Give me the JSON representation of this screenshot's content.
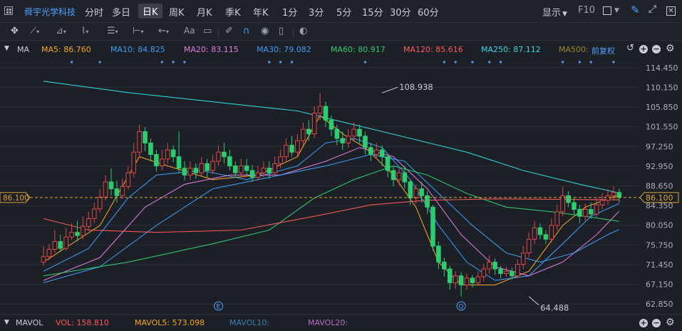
{
  "header": {
    "stock_name": "舜宇光学科技",
    "tabs": [
      "分时",
      "多日",
      "日K",
      "周K",
      "月K",
      "季K",
      "年K",
      "1分",
      "3分",
      "5分",
      "15分",
      "30分",
      "60分"
    ],
    "active_tab": "日K",
    "display_label": "显示",
    "f10_label": "F10"
  },
  "toolbar": {
    "text_tool_label": "Aa"
  },
  "ma_bar": {
    "label": "MA",
    "items": [
      {
        "text": "MA5: 86.760",
        "color": "#f5a623"
      },
      {
        "text": "MA10: 84.825",
        "color": "#3d9df5"
      },
      {
        "text": "MA20: 83.115",
        "color": "#e07ee0"
      },
      {
        "text": "MA30: 79.082",
        "color": "#3d9df5"
      },
      {
        "text": "MA60: 80.917",
        "color": "#2ecc71"
      },
      {
        "text": "MA120: 85.616",
        "color": "#ff5a5a"
      },
      {
        "text": "MA250: 87.112",
        "color": "#33d9e0"
      },
      {
        "text": "MA500:",
        "color": "#a0862e"
      }
    ],
    "adjust_label": "前复权"
  },
  "price_axis": [
    "114.450",
    "110.150",
    "105.850",
    "101.550",
    "97.250",
    "92.950",
    "88.650",
    "84.350",
    "80.050",
    "75.750",
    "71.450",
    "67.150",
    "62.850"
  ],
  "current_price": "86.100",
  "annotations": {
    "high": "108.938",
    "low": "64.488",
    "marker_e": "E",
    "marker_q": "Q"
  },
  "vol_bar": {
    "label": "MAVOL",
    "items": [
      {
        "text": "VOL: 158.810",
        "color": "#ff5a5a"
      },
      {
        "text": "MAVOL5: 573.098",
        "color": "#f5a623"
      },
      {
        "text": "MAVOL10:",
        "color": "#3d7fb8"
      },
      {
        "text": "MAVOL20:",
        "color": "#b06fc0"
      }
    ]
  },
  "chart_data": {
    "type": "candlestick",
    "y_range": [
      60.7,
      116.6
    ],
    "y_ticks": [
      114.45,
      110.15,
      105.85,
      101.55,
      97.25,
      92.95,
      88.65,
      84.35,
      80.05,
      75.75,
      71.45,
      67.15,
      62.85
    ],
    "current_price": 86.1,
    "high_label": {
      "value": 108.938,
      "index": 60
    },
    "low_label": {
      "value": 64.488,
      "index": 86
    },
    "candles": [
      [
        72.0,
        73.2,
        75.5,
        71.2
      ],
      [
        73.2,
        74.8,
        76.0,
        72.5
      ],
      [
        74.8,
        76.5,
        79.0,
        74.0
      ],
      [
        76.5,
        75.0,
        78.0,
        74.2
      ],
      [
        75.0,
        77.5,
        79.5,
        74.5
      ],
      [
        77.5,
        78.5,
        80.5,
        76.8
      ],
      [
        78.5,
        77.8,
        81.0,
        76.5
      ],
      [
        77.8,
        79.8,
        82.0,
        77.0
      ],
      [
        79.8,
        81.5,
        83.0,
        78.8
      ],
      [
        81.5,
        83.6,
        85.0,
        80.5
      ],
      [
        83.6,
        86.2,
        88.0,
        82.8
      ],
      [
        86.2,
        89.5,
        91.0,
        85.5
      ],
      [
        89.5,
        88.0,
        92.5,
        86.5
      ],
      [
        88.0,
        86.5,
        89.8,
        85.0
      ],
      [
        86.5,
        88.5,
        90.2,
        85.8
      ],
      [
        88.5,
        91.5,
        93.0,
        87.8
      ],
      [
        91.5,
        96.0,
        98.0,
        90.5
      ],
      [
        96.0,
        100.5,
        102.0,
        95.0
      ],
      [
        100.5,
        98.0,
        101.5,
        96.2
      ],
      [
        98.0,
        95.5,
        99.0,
        94.0
      ],
      [
        95.5,
        93.0,
        96.5,
        91.8
      ],
      [
        93.0,
        94.5,
        96.5,
        92.0
      ],
      [
        94.5,
        96.5,
        98.0,
        93.5
      ],
      [
        96.5,
        95.0,
        97.5,
        93.8
      ],
      [
        95.0,
        92.5,
        100.5,
        91.5
      ],
      [
        92.5,
        91.0,
        94.0,
        89.8
      ],
      [
        91.0,
        92.5,
        94.0,
        90.0
      ],
      [
        92.5,
        91.5,
        93.5,
        90.2
      ],
      [
        91.5,
        93.5,
        95.0,
        90.8
      ],
      [
        93.5,
        92.0,
        94.5,
        90.5
      ],
      [
        92.0,
        94.0,
        95.5,
        91.2
      ],
      [
        94.0,
        96.0,
        97.5,
        93.0
      ],
      [
        96.0,
        95.0,
        98.0,
        93.5
      ],
      [
        95.0,
        93.0,
        96.5,
        92.0
      ],
      [
        93.0,
        91.5,
        94.0,
        90.5
      ],
      [
        91.5,
        93.0,
        94.5,
        90.8
      ],
      [
        93.0,
        92.0,
        94.5,
        91.0
      ],
      [
        92.0,
        90.5,
        93.2,
        89.5
      ],
      [
        90.5,
        91.5,
        93.0,
        89.8
      ],
      [
        91.5,
        92.5,
        94.0,
        90.5
      ],
      [
        92.5,
        91.5,
        94.0,
        90.2
      ],
      [
        91.5,
        93.5,
        95.0,
        90.8
      ],
      [
        93.5,
        95.0,
        96.5,
        92.5
      ],
      [
        95.0,
        97.5,
        99.0,
        94.0
      ],
      [
        97.5,
        96.0,
        99.5,
        95.0
      ],
      [
        96.0,
        98.5,
        100.0,
        95.2
      ],
      [
        98.5,
        101.0,
        102.5,
        97.5
      ],
      [
        101.0,
        100.0,
        103.0,
        98.5
      ],
      [
        100.0,
        104.5,
        106.0,
        99.0
      ],
      [
        104.5,
        106.0,
        108.938,
        103.0
      ],
      [
        106.0,
        103.0,
        107.0,
        101.5
      ],
      [
        103.0,
        101.0,
        104.0,
        99.5
      ],
      [
        101.0,
        99.0,
        102.0,
        97.5
      ],
      [
        99.0,
        98.0,
        100.5,
        96.5
      ],
      [
        98.0,
        99.5,
        101.0,
        97.0
      ],
      [
        99.5,
        101.0,
        102.5,
        98.5
      ],
      [
        101.0,
        99.5,
        102.0,
        98.0
      ],
      [
        99.5,
        97.0,
        100.5,
        95.5
      ],
      [
        97.0,
        95.5,
        98.0,
        94.0
      ],
      [
        95.5,
        96.5,
        98.0,
        94.5
      ],
      [
        96.5,
        95.0,
        97.5,
        93.0
      ],
      [
        95.0,
        92.0,
        95.5,
        90.5
      ],
      [
        92.0,
        90.0,
        93.0,
        88.5
      ],
      [
        90.0,
        91.5,
        92.5,
        88.8
      ],
      [
        91.5,
        89.5,
        93.0,
        88.0
      ],
      [
        89.5,
        86.0,
        90.0,
        84.5
      ],
      [
        86.0,
        88.0,
        89.0,
        84.8
      ],
      [
        88.0,
        86.5,
        89.5,
        85.0
      ],
      [
        86.5,
        84.0,
        87.5,
        82.5
      ],
      [
        84.0,
        75.5,
        84.5,
        74.5
      ],
      [
        75.5,
        72.0,
        76.5,
        70.5
      ],
      [
        72.0,
        70.5,
        73.0,
        68.8
      ],
      [
        70.5,
        67.5,
        71.2,
        66.0
      ],
      [
        67.5,
        69.0,
        70.0,
        66.2
      ],
      [
        69.0,
        67.0,
        69.8,
        64.488
      ],
      [
        67.0,
        68.5,
        69.5,
        66.0
      ],
      [
        68.5,
        67.5,
        69.2,
        66.5
      ],
      [
        67.5,
        68.8,
        70.0,
        67.0
      ],
      [
        68.8,
        70.5,
        71.5,
        67.8
      ],
      [
        70.5,
        72.0,
        73.5,
        69.5
      ],
      [
        72.0,
        70.5,
        72.8,
        69.2
      ],
      [
        70.5,
        69.5,
        71.2,
        68.5
      ],
      [
        69.5,
        70.0,
        71.0,
        68.8
      ],
      [
        70.0,
        69.0,
        70.8,
        68.2
      ],
      [
        69.0,
        71.5,
        72.5,
        68.5
      ],
      [
        71.5,
        74.0,
        75.5,
        70.5
      ],
      [
        74.0,
        77.0,
        78.5,
        73.0
      ],
      [
        77.0,
        79.5,
        81.0,
        76.0
      ],
      [
        79.5,
        78.0,
        80.5,
        77.0
      ],
      [
        78.0,
        77.0,
        79.0,
        76.0
      ],
      [
        77.0,
        80.0,
        81.5,
        76.2
      ],
      [
        80.0,
        83.0,
        84.5,
        79.0
      ],
      [
        83.0,
        86.5,
        88.5,
        82.0
      ],
      [
        86.5,
        85.0,
        87.5,
        84.0
      ],
      [
        85.0,
        83.5,
        86.0,
        82.5
      ],
      [
        83.5,
        82.0,
        84.5,
        80.5
      ],
      [
        82.0,
        83.5,
        84.8,
        81.0
      ],
      [
        83.5,
        82.5,
        85.0,
        81.5
      ],
      [
        82.5,
        84.5,
        86.0,
        81.8
      ],
      [
        84.5,
        85.5,
        87.0,
        83.5
      ],
      [
        85.5,
        86.5,
        88.0,
        84.5
      ],
      [
        86.5,
        87.2,
        88.5,
        85.5
      ],
      [
        87.2,
        86.1,
        88.0,
        85.0
      ]
    ],
    "ma_series": [
      {
        "name": "MA5",
        "color": "#f5a623",
        "points": [
          [
            0,
            72
          ],
          [
            10,
            80
          ],
          [
            17,
            95
          ],
          [
            22,
            93
          ],
          [
            30,
            90
          ],
          [
            38,
            91
          ],
          [
            45,
            95
          ],
          [
            49,
            104
          ],
          [
            53,
            100
          ],
          [
            57,
            97
          ],
          [
            62,
            91
          ],
          [
            66,
            84
          ],
          [
            70,
            72
          ],
          [
            74,
            67
          ],
          [
            80,
            67
          ],
          [
            86,
            70
          ],
          [
            92,
            80
          ],
          [
            96,
            84
          ],
          [
            102,
            86.7
          ]
        ]
      },
      {
        "name": "MA10",
        "color": "#3d9df5",
        "points": [
          [
            0,
            70
          ],
          [
            8,
            75
          ],
          [
            15,
            86
          ],
          [
            20,
            91
          ],
          [
            28,
            92
          ],
          [
            36,
            90
          ],
          [
            45,
            93
          ],
          [
            50,
            98
          ],
          [
            55,
            99
          ],
          [
            60,
            97
          ],
          [
            65,
            90
          ],
          [
            70,
            80
          ],
          [
            75,
            72
          ],
          [
            80,
            68
          ],
          [
            86,
            69
          ],
          [
            92,
            76
          ],
          [
            97,
            82
          ],
          [
            102,
            84.8
          ]
        ]
      },
      {
        "name": "MA20",
        "color": "#e07ee0",
        "points": [
          [
            0,
            68
          ],
          [
            10,
            73
          ],
          [
            18,
            84
          ],
          [
            25,
            89
          ],
          [
            33,
            91
          ],
          [
            42,
            91
          ],
          [
            50,
            94
          ],
          [
            56,
            97
          ],
          [
            62,
            95
          ],
          [
            68,
            88
          ],
          [
            74,
            78
          ],
          [
            80,
            71
          ],
          [
            86,
            69
          ],
          [
            92,
            72
          ],
          [
            98,
            78
          ],
          [
            102,
            83.1
          ]
        ]
      },
      {
        "name": "MA30",
        "color": "#3d9df5",
        "points": [
          [
            0,
            67.5
          ],
          [
            10,
            71
          ],
          [
            20,
            80
          ],
          [
            30,
            88
          ],
          [
            40,
            90.5
          ],
          [
            50,
            93
          ],
          [
            58,
            95.5
          ],
          [
            64,
            94
          ],
          [
            70,
            87
          ],
          [
            76,
            80
          ],
          [
            82,
            74
          ],
          [
            88,
            72
          ],
          [
            94,
            74
          ],
          [
            100,
            78
          ],
          [
            102,
            79.1
          ]
        ]
      },
      {
        "name": "MA60",
        "color": "#2ecc71",
        "points": [
          [
            0,
            69
          ],
          [
            15,
            72
          ],
          [
            30,
            76
          ],
          [
            40,
            79
          ],
          [
            48,
            86
          ],
          [
            55,
            90
          ],
          [
            62,
            93
          ],
          [
            68,
            91
          ],
          [
            75,
            87
          ],
          [
            82,
            84
          ],
          [
            90,
            83
          ],
          [
            96,
            82
          ],
          [
            102,
            80.9
          ]
        ]
      },
      {
        "name": "MA120",
        "color": "#ff5a5a",
        "points": [
          [
            0,
            81.5
          ],
          [
            8,
            79
          ],
          [
            20,
            78.5
          ],
          [
            35,
            79
          ],
          [
            48,
            82
          ],
          [
            58,
            84.5
          ],
          [
            68,
            85.5
          ],
          [
            80,
            85.8
          ],
          [
            90,
            85.7
          ],
          [
            102,
            85.6
          ]
        ]
      },
      {
        "name": "MA250",
        "color": "#33d9e0",
        "points": [
          [
            0,
            111.5
          ],
          [
            15,
            109
          ],
          [
            30,
            107
          ],
          [
            45,
            105
          ],
          [
            55,
            102
          ],
          [
            65,
            99
          ],
          [
            75,
            96
          ],
          [
            85,
            92
          ],
          [
            95,
            89
          ],
          [
            102,
            87.1
          ]
        ]
      }
    ]
  }
}
